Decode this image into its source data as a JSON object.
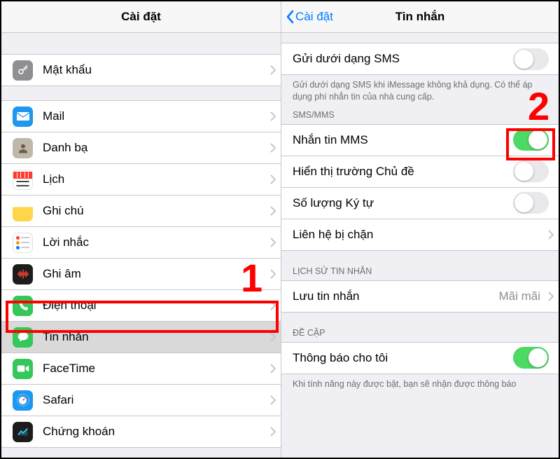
{
  "left": {
    "title": "Cài đặt",
    "items": [
      {
        "id": "passwords",
        "label": "Mật khẩu"
      },
      {
        "id": "mail",
        "label": "Mail"
      },
      {
        "id": "contacts",
        "label": "Danh bạ"
      },
      {
        "id": "calendar",
        "label": "Lịch"
      },
      {
        "id": "notes",
        "label": "Ghi chú"
      },
      {
        "id": "reminders",
        "label": "Lời nhắc"
      },
      {
        "id": "voicememo",
        "label": "Ghi âm"
      },
      {
        "id": "phone",
        "label": "Điện thoại"
      },
      {
        "id": "messages",
        "label": "Tin nhắn"
      },
      {
        "id": "facetime",
        "label": "FaceTime"
      },
      {
        "id": "safari",
        "label": "Safari"
      },
      {
        "id": "stocks",
        "label": "Chứng khoán"
      }
    ]
  },
  "right": {
    "back": "Cài đặt",
    "title": "Tin nhắn",
    "send_as_sms": "Gửi dưới dạng SMS",
    "send_as_sms_footer": "Gửi dưới dạng SMS khi iMessage không khả dụng. Có thể áp dụng phí nhắn tin của nhà cung cấp.",
    "section_smsmms": "SMS/MMS",
    "mms": "Nhắn tin MMS",
    "show_subject": "Hiển thị trường Chủ đề",
    "char_count": "Số lượng Ký tự",
    "blocked": "Liên hệ bị chặn",
    "section_history": "LỊCH SỬ TIN NHẮN",
    "keep_messages": "Lưu tin nhắn",
    "keep_messages_value": "Mãi mãi",
    "section_mention": "ĐỀ CẬP",
    "notify_me": "Thông báo cho tôi",
    "notify_me_footer": "Khi tính năng này được bật, bạn sẽ nhận được thông báo"
  },
  "callouts": {
    "one": "1",
    "two": "2"
  }
}
